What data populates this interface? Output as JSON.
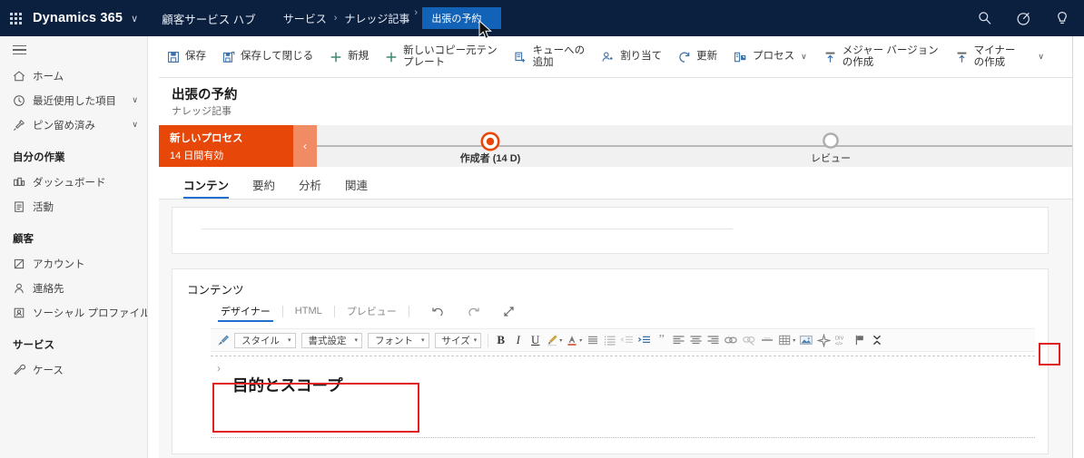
{
  "topnav": {
    "waffle_label": "app-launcher",
    "brand": "Dynamics 365",
    "brand_chevron": "∨",
    "app_name": "顧客サービス ハブ",
    "breadcrumb": [
      {
        "label": "サービス",
        "icon": ""
      },
      {
        "label": "ナレッジ記事",
        "icon": ""
      }
    ],
    "breadcrumb_separator": "›",
    "active_crumb": "出張の予約",
    "active_crumb_lead": "›",
    "icons": [
      {
        "name": "search-icon",
        "glyph": "search"
      },
      {
        "name": "assistant-icon",
        "glyph": "assistant"
      },
      {
        "name": "lightbulb-help-icon",
        "glyph": "bulb"
      }
    ],
    "accent_blue": "#1262b7",
    "bg": "#0b1f3f"
  },
  "sidebar": {
    "hamburger": "site-map-toggle",
    "items": [
      {
        "label": "ホーム",
        "icon": "home-icon",
        "chevron": ""
      },
      {
        "label": "最近使用した項目",
        "icon": "clock-icon",
        "chevron": "∨"
      },
      {
        "label": "ピン留め済み",
        "icon": "pin-icon",
        "chevron": "∨"
      }
    ],
    "groups": [
      {
        "title": "自分の作業",
        "items": [
          {
            "label": "ダッシュボード",
            "icon": "dashboard-icon"
          },
          {
            "label": "活動",
            "icon": "activity-icon"
          }
        ]
      },
      {
        "title": "顧客",
        "items": [
          {
            "label": "アカウント",
            "icon": "account-icon"
          },
          {
            "label": "連絡先",
            "icon": "contact-icon"
          },
          {
            "label": "ソーシャル プロファイル",
            "icon": "social-profile-icon"
          }
        ]
      },
      {
        "title": "サービス",
        "items": [
          {
            "label": "ケース",
            "icon": "case-icon"
          }
        ]
      }
    ]
  },
  "commandbar": {
    "buttons": [
      {
        "label": "保存",
        "icon": "save-icon",
        "chevron": ""
      },
      {
        "label": "保存して閉じる",
        "icon": "save-close-icon",
        "chevron": ""
      },
      {
        "label": "新規",
        "icon": "plus-icon",
        "chevron": ""
      },
      {
        "label": "新しいコピー元テン\nプレート",
        "icon": "plus-icon",
        "chevron": ""
      },
      {
        "label": "キューへの\n追加",
        "icon": "queue-icon",
        "chevron": ""
      },
      {
        "label": "割り当て",
        "icon": "assign-user-icon",
        "chevron": ""
      },
      {
        "label": "更新",
        "icon": "refresh-icon",
        "chevron": ""
      },
      {
        "label": "プロセス",
        "icon": "process-icon",
        "chevron": "∨"
      },
      {
        "label": "メジャー バージョン\nの作成",
        "icon": "major-version-icon",
        "chevron": ""
      },
      {
        "label": "マイナー\nの作成",
        "icon": "minor-version-icon",
        "chevron": ""
      }
    ],
    "overflow": "∨"
  },
  "page": {
    "title": "出張の予約",
    "subtitle": "ナレッジ記事"
  },
  "bpf": {
    "process_name": "新しいプロセス",
    "process_validity": "14 日間有効",
    "prev_chevron": "‹",
    "bar_color": "#e8470a",
    "stages": [
      {
        "label": "作成者 (14 D)",
        "state": "active"
      },
      {
        "label": "レビュー",
        "state": "inactive"
      }
    ]
  },
  "tabs": [
    {
      "label": "コンテン",
      "selected": true
    },
    {
      "label": "要約",
      "selected": false
    },
    {
      "label": "分析",
      "selected": false
    },
    {
      "label": "関連",
      "selected": false
    }
  ],
  "content_section": {
    "title": "コンテンツ",
    "editor_modes": [
      {
        "label": "デザイナー",
        "selected": true
      },
      {
        "label": "HTML",
        "selected": false
      },
      {
        "label": "プレビュー",
        "selected": false
      }
    ],
    "history_buttons": [
      {
        "name": "undo-icon"
      },
      {
        "name": "redo-icon"
      },
      {
        "name": "expand-diagonal-icon"
      }
    ],
    "toolbar": [
      {
        "name": "format-painter-icon",
        "type": "icon"
      },
      {
        "name": "styles-dropdown",
        "type": "combo",
        "value": "スタイル",
        "arrow": "▾"
      },
      {
        "name": "format-dropdown",
        "type": "combo",
        "value": "書式設定",
        "arrow": "▾"
      },
      {
        "name": "font-dropdown",
        "type": "combo",
        "value": "フォント",
        "arrow": "▾"
      },
      {
        "name": "size-dropdown",
        "type": "combo",
        "value": "サイズ",
        "arrow": "▾"
      },
      {
        "name": "bold-button",
        "type": "text",
        "value": "B"
      },
      {
        "name": "italic-button",
        "type": "text",
        "value": "I"
      },
      {
        "name": "underline-button",
        "type": "text",
        "value": "U"
      },
      {
        "name": "text-highlight-color-icon",
        "type": "icon",
        "arrow": "▾"
      },
      {
        "name": "font-color-icon",
        "type": "icon",
        "arrow": "▾"
      },
      {
        "name": "bulleted-list-icon",
        "type": "icon"
      },
      {
        "name": "numbered-list-icon",
        "type": "icon"
      },
      {
        "name": "decrease-indent-icon",
        "type": "icon"
      },
      {
        "name": "increase-indent-icon",
        "type": "icon"
      },
      {
        "name": "blockquote-icon",
        "type": "text",
        "value": "”"
      },
      {
        "name": "align-left-icon",
        "type": "icon"
      },
      {
        "name": "align-center-icon",
        "type": "icon"
      },
      {
        "name": "align-right-icon",
        "type": "icon"
      },
      {
        "name": "insert-link-icon",
        "type": "icon"
      },
      {
        "name": "unlink-icon",
        "type": "icon"
      },
      {
        "name": "horizontal-rule-icon",
        "type": "icon"
      },
      {
        "name": "insert-table-icon",
        "type": "icon",
        "arrow": "▾"
      },
      {
        "name": "insert-image-icon",
        "type": "icon"
      },
      {
        "name": "special-character-icon",
        "type": "icon"
      },
      {
        "name": "source-code-icon",
        "type": "icon"
      },
      {
        "name": "flag-icon",
        "type": "icon"
      },
      {
        "name": "collapse-toolbar-icon",
        "type": "icon",
        "highlighted": true
      }
    ],
    "body": {
      "collapse_chevron": "›",
      "heading": "目的とスコープ"
    }
  },
  "highlights": {
    "color": "#e02020",
    "regions": [
      {
        "name": "collapse-toolbar-highlight",
        "target": "collapse-toolbar-icon"
      },
      {
        "name": "heading-highlight",
        "target": "content-heading"
      }
    ]
  }
}
